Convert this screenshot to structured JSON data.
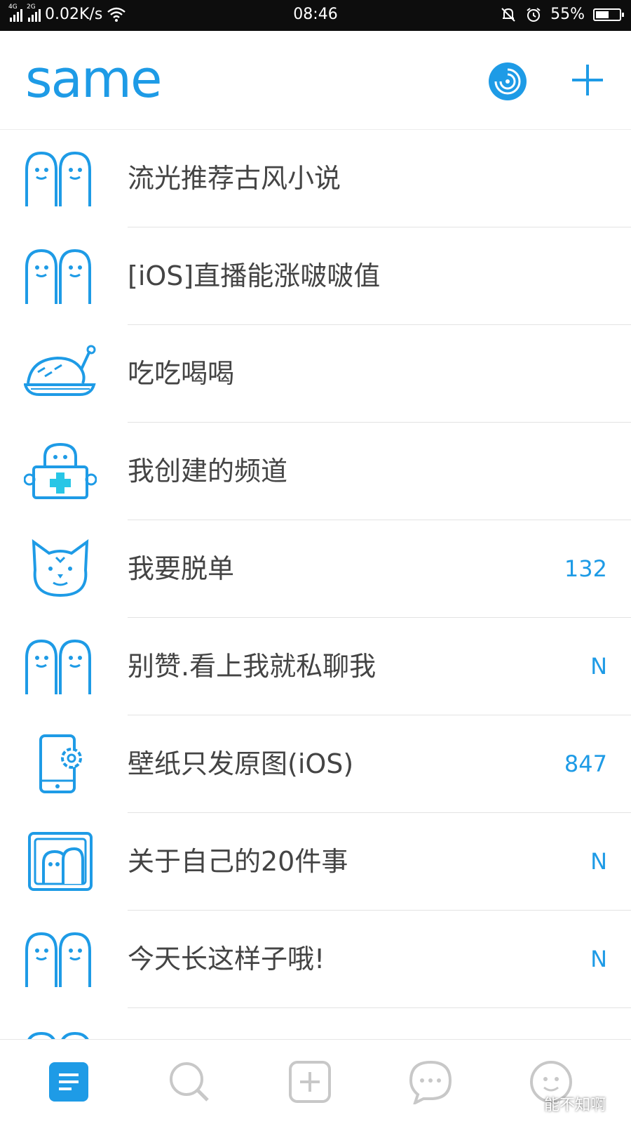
{
  "status_bar": {
    "network_4g": "4G",
    "network_2g": "2G",
    "speed": "0.02K/s",
    "time": "08:46",
    "battery": "55%",
    "battery_level": 0.55
  },
  "header": {
    "logo": "same",
    "disc_icon": "disc-icon",
    "add_icon": "plus-icon"
  },
  "channels": [
    {
      "name": "流光推荐古风小说",
      "count": "",
      "icon": "ghost-pair-icon"
    },
    {
      "name": "[iOS]直播能涨啵啵值",
      "count": "",
      "icon": "ghost-pair-icon"
    },
    {
      "name": "吃吃喝喝",
      "count": "",
      "icon": "roast-chicken-icon"
    },
    {
      "name": "我创建的频道",
      "count": "",
      "icon": "ghost-medkit-icon"
    },
    {
      "name": "我要脱单",
      "count": "132",
      "icon": "cat-face-icon"
    },
    {
      "name": "别赞.看上我就私聊我",
      "count": "N",
      "icon": "ghost-pair-icon"
    },
    {
      "name": "壁纸只发原图(iOS)",
      "count": "847",
      "icon": "phone-settings-icon"
    },
    {
      "name": "关于自己的20件事",
      "count": "N",
      "icon": "framed-ghost-icon"
    },
    {
      "name": "今天长这样子哦!",
      "count": "N",
      "icon": "ghost-pair-icon"
    }
  ],
  "bottom_nav": [
    {
      "name": "channels-tab",
      "icon": "list-icon",
      "active": true
    },
    {
      "name": "search-tab",
      "icon": "search-icon",
      "active": false
    },
    {
      "name": "add-tab",
      "icon": "add-square-icon",
      "active": false
    },
    {
      "name": "messages-tab",
      "icon": "chat-bubble-icon",
      "active": false
    },
    {
      "name": "profile-tab",
      "icon": "face-icon",
      "active": false
    }
  ],
  "watermark": "能不知啊",
  "colors": {
    "accent": "#1e9be6",
    "text": "#444444",
    "inactive": "#c8c8c8"
  }
}
